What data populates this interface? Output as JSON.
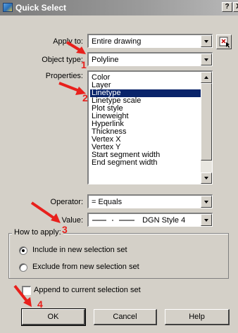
{
  "window": {
    "title": "Quick Select",
    "help_btn": "?",
    "close_btn": "X"
  },
  "apply_to": {
    "label": "Apply to:",
    "value": "Entire drawing"
  },
  "object_type": {
    "label": "Object type:",
    "value": "Polyline"
  },
  "properties": {
    "label": "Properties:",
    "items": [
      "Color",
      "Layer",
      "Linetype",
      "Linetype scale",
      "Plot style",
      "Lineweight",
      "Hyperlink",
      "Thickness",
      "Vertex X",
      "Vertex Y",
      "Start segment width",
      "End segment width"
    ],
    "selected": "Linetype"
  },
  "operator": {
    "label": "Operator:",
    "value": "= Equals"
  },
  "value": {
    "label": "Value:",
    "text": "DGN Style 4"
  },
  "how_to_apply": {
    "caption": "How to apply:",
    "include": "Include in new selection set",
    "exclude": "Exclude from new selection set",
    "selected": "include"
  },
  "append": {
    "label": "Append to current selection set",
    "checked": false
  },
  "buttons": {
    "ok": "OK",
    "cancel": "Cancel",
    "help": "Help"
  },
  "annotations": {
    "n1": "1",
    "n2": "2",
    "n3": "3",
    "n4": "4",
    "color": "#e8201c"
  }
}
